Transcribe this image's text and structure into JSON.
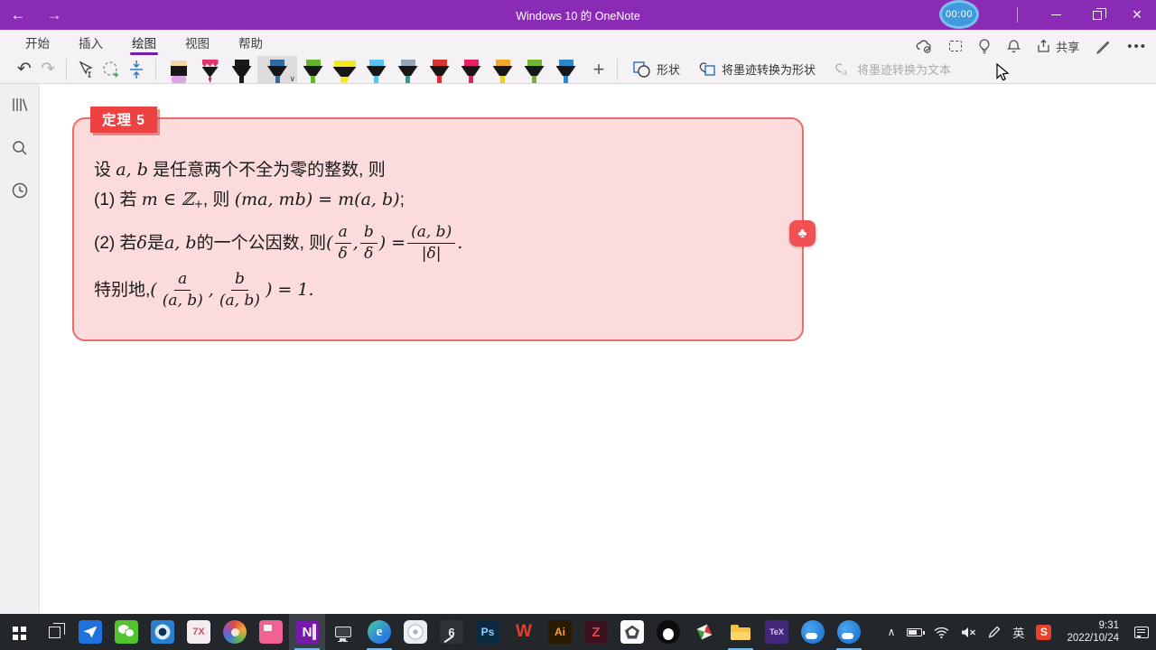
{
  "titlebar": {
    "title": "Windows 10 的 OneNote",
    "timer": "00:00"
  },
  "ribbon": {
    "tabs": [
      {
        "label": "开始"
      },
      {
        "label": "插入"
      },
      {
        "label": "绘图"
      },
      {
        "label": "视图"
      },
      {
        "label": "帮助"
      }
    ],
    "active_tab": "绘图",
    "buttons": {
      "shapes": "形状",
      "ink_to_shape": "将墨迹转换为形状",
      "ink_to_text": "将墨迹转换为文本",
      "share": "共享"
    },
    "pens": [
      {
        "name": "eraser",
        "kind": "eraser",
        "cap": "#f0d9a6",
        "tip": "#d9a7e6",
        "selected": false
      },
      {
        "name": "pencil-crimson",
        "kind": "pencil",
        "cap": "#e3356b",
        "tip": "#c2185b",
        "selected": false
      },
      {
        "name": "pen-black",
        "kind": "pen",
        "cap": "#1a1a1a",
        "tip": "#1a1a1a",
        "selected": false
      },
      {
        "name": "pen-blue",
        "kind": "pen",
        "cap": "#2f6b9e",
        "tip": "#2f6b9e",
        "selected": true
      },
      {
        "name": "pen-green",
        "kind": "pen",
        "cap": "#67b32e",
        "tip": "#67b32e",
        "selected": false
      },
      {
        "name": "highlighter-yellow",
        "kind": "highlighter",
        "cap": "#f2ea1c",
        "tip": "#f2ea1c",
        "selected": false
      },
      {
        "name": "pen-lightblue",
        "kind": "pen",
        "cap": "#58c2f1",
        "tip": "#58c2f1",
        "selected": false
      },
      {
        "name": "pen-silver-teal",
        "kind": "pen",
        "cap": "#93a8b4",
        "tip": "#2e9c93",
        "selected": false
      },
      {
        "name": "pen-red",
        "kind": "pen",
        "cap": "#d63230",
        "tip": "#d63230",
        "selected": false
      },
      {
        "name": "pen-crimson",
        "kind": "pen",
        "cap": "#e91e63",
        "tip": "#e91e63",
        "selected": false
      },
      {
        "name": "pen-amber",
        "kind": "pen",
        "cap": "#f0a828",
        "tip": "#e8d12c",
        "selected": false
      },
      {
        "name": "pen-green-2",
        "kind": "pen",
        "cap": "#74b32e",
        "tip": "#74b32e",
        "selected": false
      },
      {
        "name": "pen-blue-2",
        "kind": "pen",
        "cap": "#2f86c9",
        "tip": "#2f86c9",
        "selected": false
      }
    ]
  },
  "content": {
    "badge": "定理 5",
    "line1": [
      "设 ",
      "a, b",
      " 是任意两个不全为零的整数, 则"
    ],
    "line2": [
      "(1) 若 ",
      "m ∈ ℤ",
      "+",
      ", 则 ",
      "(ma, mb) = m(a, b)",
      ";"
    ],
    "line3": {
      "segs": [
        "(2) 若 ",
        "δ",
        " 是 ",
        "a, b",
        " 的一个公因数, 则 ",
        "(",
        ", ",
        ") = ",
        "."
      ],
      "f1": {
        "n": "a",
        "d": "δ"
      },
      "f2": {
        "n": "b",
        "d": "δ"
      },
      "f3": {
        "n": "(a, b)",
        "d": "|δ|"
      }
    },
    "line4": {
      "segs": [
        "特别地, ",
        "(",
        ", ",
        ") = 1."
      ],
      "f1": {
        "n": "a",
        "d": "(a, b)"
      },
      "f2": {
        "n": "b",
        "d": "(a, b)"
      }
    },
    "accent_border": "#ef6a6a",
    "accent_fill": "#fbdbdb",
    "badge_color": "#ee4242"
  },
  "taskbar": {
    "apps": [
      {
        "name": "start-button",
        "kind": "start"
      },
      {
        "name": "task-view-button",
        "kind": "taskview"
      },
      {
        "name": "app-blue-plane",
        "kind": "plane"
      },
      {
        "name": "wechat",
        "kind": "wechat"
      },
      {
        "name": "app-shutter",
        "kind": "shutter"
      },
      {
        "name": "app-7x",
        "kind": "tile",
        "bg": "#f3edef",
        "fg": "#c2536b",
        "glyph": "7X",
        "fs": "11"
      },
      {
        "name": "app-palette",
        "kind": "palette"
      },
      {
        "name": "app-pink",
        "kind": "pink"
      },
      {
        "name": "onenote",
        "kind": "onenote",
        "glyph": "N",
        "active": true,
        "running": true
      },
      {
        "name": "app-display",
        "kind": "monitor"
      },
      {
        "name": "microsoft-edge",
        "kind": "edge",
        "glyph": "e",
        "running": true
      },
      {
        "name": "app-flower",
        "kind": "flower"
      },
      {
        "name": "app-hand-6",
        "kind": "hand6",
        "glyph": "6"
      },
      {
        "name": "photoshop",
        "kind": "tile",
        "bg": "#0c2b42",
        "fg": "#8fd0ff",
        "glyph": "Ps",
        "fs": "12"
      },
      {
        "name": "wps-office",
        "kind": "tile",
        "bg": "transparent",
        "fg": "#e63f30",
        "glyph": "W",
        "fs": "19"
      },
      {
        "name": "illustrator",
        "kind": "tile",
        "bg": "#2a1a00",
        "fg": "#ff9b33",
        "glyph": "Ai",
        "fs": "12"
      },
      {
        "name": "app-z",
        "kind": "tile",
        "bg": "#3d1220",
        "fg": "#e04545",
        "glyph": "Z",
        "fs": "15"
      },
      {
        "name": "geogebra",
        "kind": "geogebra"
      },
      {
        "name": "qq",
        "kind": "qq"
      },
      {
        "name": "app-pinwheel",
        "kind": "pinwheel"
      },
      {
        "name": "file-explorer",
        "kind": "folder",
        "running": true
      },
      {
        "name": "texworks",
        "kind": "tex",
        "glyph": "TeX"
      },
      {
        "name": "qq-browser-1",
        "kind": "qbrowser"
      },
      {
        "name": "qq-browser-2",
        "kind": "qbrowser",
        "running": true
      }
    ],
    "tray": {
      "ime": "英",
      "sogou": "S"
    },
    "clock": {
      "time": "9:31",
      "date": "2022/10/24"
    }
  }
}
